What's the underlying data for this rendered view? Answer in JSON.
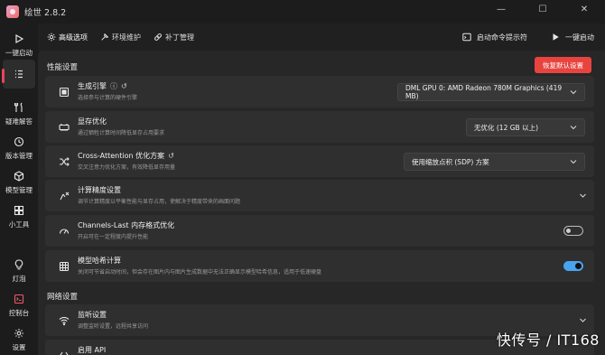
{
  "app": {
    "title": "绘世 2.8.2"
  },
  "window": {
    "minimize": "—",
    "maximize": "☐",
    "close": "✕"
  },
  "sidebar": {
    "items": [
      {
        "label": "一键启动",
        "icon": "play-icon"
      },
      {
        "label": "",
        "icon": "list-icon",
        "active": true
      },
      {
        "label": "疑难解答",
        "icon": "troubleshoot-icon"
      },
      {
        "label": "版本管理",
        "icon": "history-icon"
      },
      {
        "label": "模型管理",
        "icon": "cube-icon"
      },
      {
        "label": "小工具",
        "icon": "grid-icon"
      },
      {
        "label": "灯泡",
        "icon": "lightbulb-icon"
      },
      {
        "label": "控制台",
        "icon": "console-icon"
      },
      {
        "label": "设置",
        "icon": "gear-icon"
      }
    ]
  },
  "topbar": {
    "tabs": [
      {
        "label": "高级选项",
        "icon": "gear-icon",
        "active": true
      },
      {
        "label": "环境维护",
        "icon": "tools-icon"
      },
      {
        "label": "补丁管理",
        "icon": "patch-icon"
      }
    ],
    "console_label": "启动命令提示符",
    "launch_label": "一键启动"
  },
  "performance": {
    "title": "性能设置",
    "reset_label": "恢复默认设置",
    "cards": [
      {
        "title": "生成引擎",
        "desc": "选择参与计算的硬件引擎",
        "value": "DML GPU 0: AMD Radeon 780M Graphics (419 MB)",
        "icon": "engine-icon"
      },
      {
        "title": "显存优化",
        "desc": "通过牺牲计算时间降低显存占用要求",
        "value": "无优化 (12 GB 以上)",
        "icon": "memory-icon"
      },
      {
        "title": "Cross-Attention 优化方案",
        "desc": "交叉注意力优化方案，有效降低显存用量",
        "value": "使用缩放点积 (SDP) 方案",
        "icon": "shuffle-icon"
      },
      {
        "title": "计算精度设置",
        "desc": "调节计算精度以平衡性能与显存占用，使解决于精度带来的画面问题",
        "icon": "precision-icon"
      },
      {
        "title": "Channels-Last 内存格式优化",
        "desc": "开启可在一定程度内提升性能",
        "icon": "speed-icon",
        "toggle": "关"
      },
      {
        "title": "模型哈希计算",
        "desc": "关闭可节省启动时间，但会存在图片内与图片生成数据中无法正确显示模型哈希信息，适用于低速硬盘",
        "icon": "hash-icon",
        "toggle": "开"
      }
    ]
  },
  "network": {
    "title": "网络设置",
    "cards": [
      {
        "title": "监听设置",
        "desc": "调整监听设置，远程共享访问",
        "icon": "wifi-icon"
      },
      {
        "title": "启用 API",
        "desc": "",
        "icon": "api-icon"
      }
    ]
  },
  "watermark": "快传号 / IT168"
}
